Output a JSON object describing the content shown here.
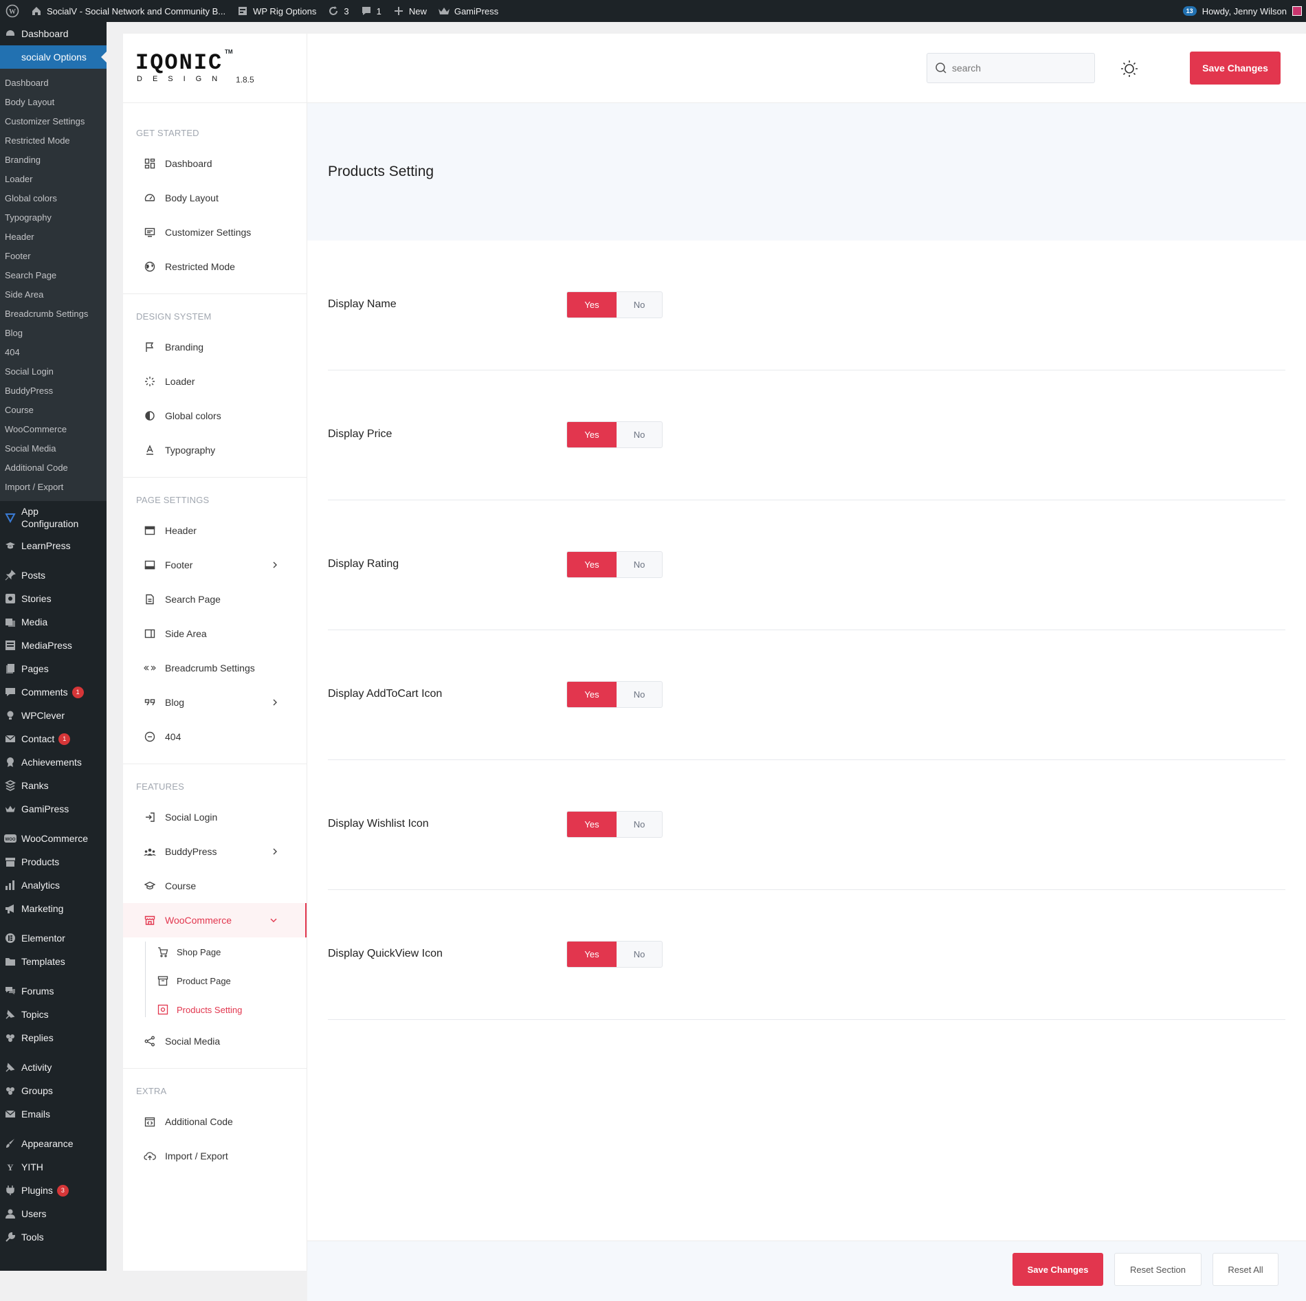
{
  "adminbar": {
    "site_title": "SocialV - Social Network and Community B...",
    "rig_options": "WP Rig Options",
    "updates_count": "3",
    "comments_count": "1",
    "new_label": "New",
    "gamipress": "GamiPress",
    "notif_count": "13",
    "howdy": "Howdy, Jenny Wilson"
  },
  "wpmenu": {
    "dashboard": "Dashboard",
    "current": "socialv Options",
    "submenu": [
      "Dashboard",
      "Body Layout",
      "Customizer Settings",
      "Restricted Mode",
      "Branding",
      "Loader",
      "Global colors",
      "Typography",
      "Header",
      "Footer",
      "Search Page",
      "Side Area",
      "Breadcrumb Settings",
      "Blog",
      "404",
      "Social Login",
      "BuddyPress",
      "Course",
      "WooCommerce",
      "Social Media",
      "Additional Code",
      "Import / Export"
    ],
    "app_config": "App Configuration",
    "learnpress": "LearnPress",
    "posts": "Posts",
    "stories": "Stories",
    "media": "Media",
    "mediapress": "MediaPress",
    "pages": "Pages",
    "comments": "Comments",
    "comments_badge": "1",
    "wpclever": "WPClever",
    "contact": "Contact",
    "contact_badge": "1",
    "achievements": "Achievements",
    "ranks": "Ranks",
    "gamipress": "GamiPress",
    "woocommerce": "WooCommerce",
    "products": "Products",
    "analytics": "Analytics",
    "marketing": "Marketing",
    "elementor": "Elementor",
    "templates": "Templates",
    "forums": "Forums",
    "topics": "Topics",
    "replies": "Replies",
    "activity": "Activity",
    "groups": "Groups",
    "emails": "Emails",
    "appearance": "Appearance",
    "yith": "YITH",
    "plugins": "Plugins",
    "plugins_badge": "3",
    "users": "Users",
    "tools": "Tools"
  },
  "logo": {
    "word": "IQONIC",
    "tm": "TM",
    "sub": "DESIGN",
    "version": "1.8.5"
  },
  "topbar": {
    "search_placeholder": "search",
    "save": "Save Changes"
  },
  "sidebar": {
    "get_started": "GET STARTED",
    "dashboard": "Dashboard",
    "body_layout": "Body Layout",
    "customizer": "Customizer Settings",
    "restricted": "Restricted Mode",
    "design_system": "DESIGN SYSTEM",
    "branding": "Branding",
    "loader": "Loader",
    "global_colors": "Global colors",
    "typography": "Typography",
    "page_settings": "PAGE SETTINGS",
    "header": "Header",
    "footer": "Footer",
    "search_page": "Search Page",
    "side_area": "Side Area",
    "breadcrumb": "Breadcrumb Settings",
    "blog": "Blog",
    "p404": "404",
    "features": "FEATURES",
    "social_login": "Social Login",
    "buddypress": "BuddyPress",
    "course": "Course",
    "woocommerce": "WooCommerce",
    "shop_page": "Shop Page",
    "product_page": "Product Page",
    "products_setting": "Products Setting",
    "social_media": "Social Media",
    "extra": "EXTRA",
    "additional_code": "Additional Code",
    "import_export": "Import / Export"
  },
  "main": {
    "title": "Products Setting",
    "yes": "Yes",
    "no": "No",
    "options": [
      {
        "label": "Display Name",
        "value": "Yes"
      },
      {
        "label": "Display Price",
        "value": "Yes"
      },
      {
        "label": "Display Rating",
        "value": "Yes"
      },
      {
        "label": "Display AddToCart Icon",
        "value": "Yes"
      },
      {
        "label": "Display Wishlist Icon",
        "value": "Yes"
      },
      {
        "label": "Display QuickView Icon",
        "value": "Yes"
      }
    ]
  },
  "footer": {
    "save": "Save Changes",
    "reset_section": "Reset Section",
    "reset_all": "Reset All"
  },
  "colors": {
    "accent": "#e2364e",
    "wp_dark": "#1d2327",
    "wp_blue": "#2271b1"
  }
}
